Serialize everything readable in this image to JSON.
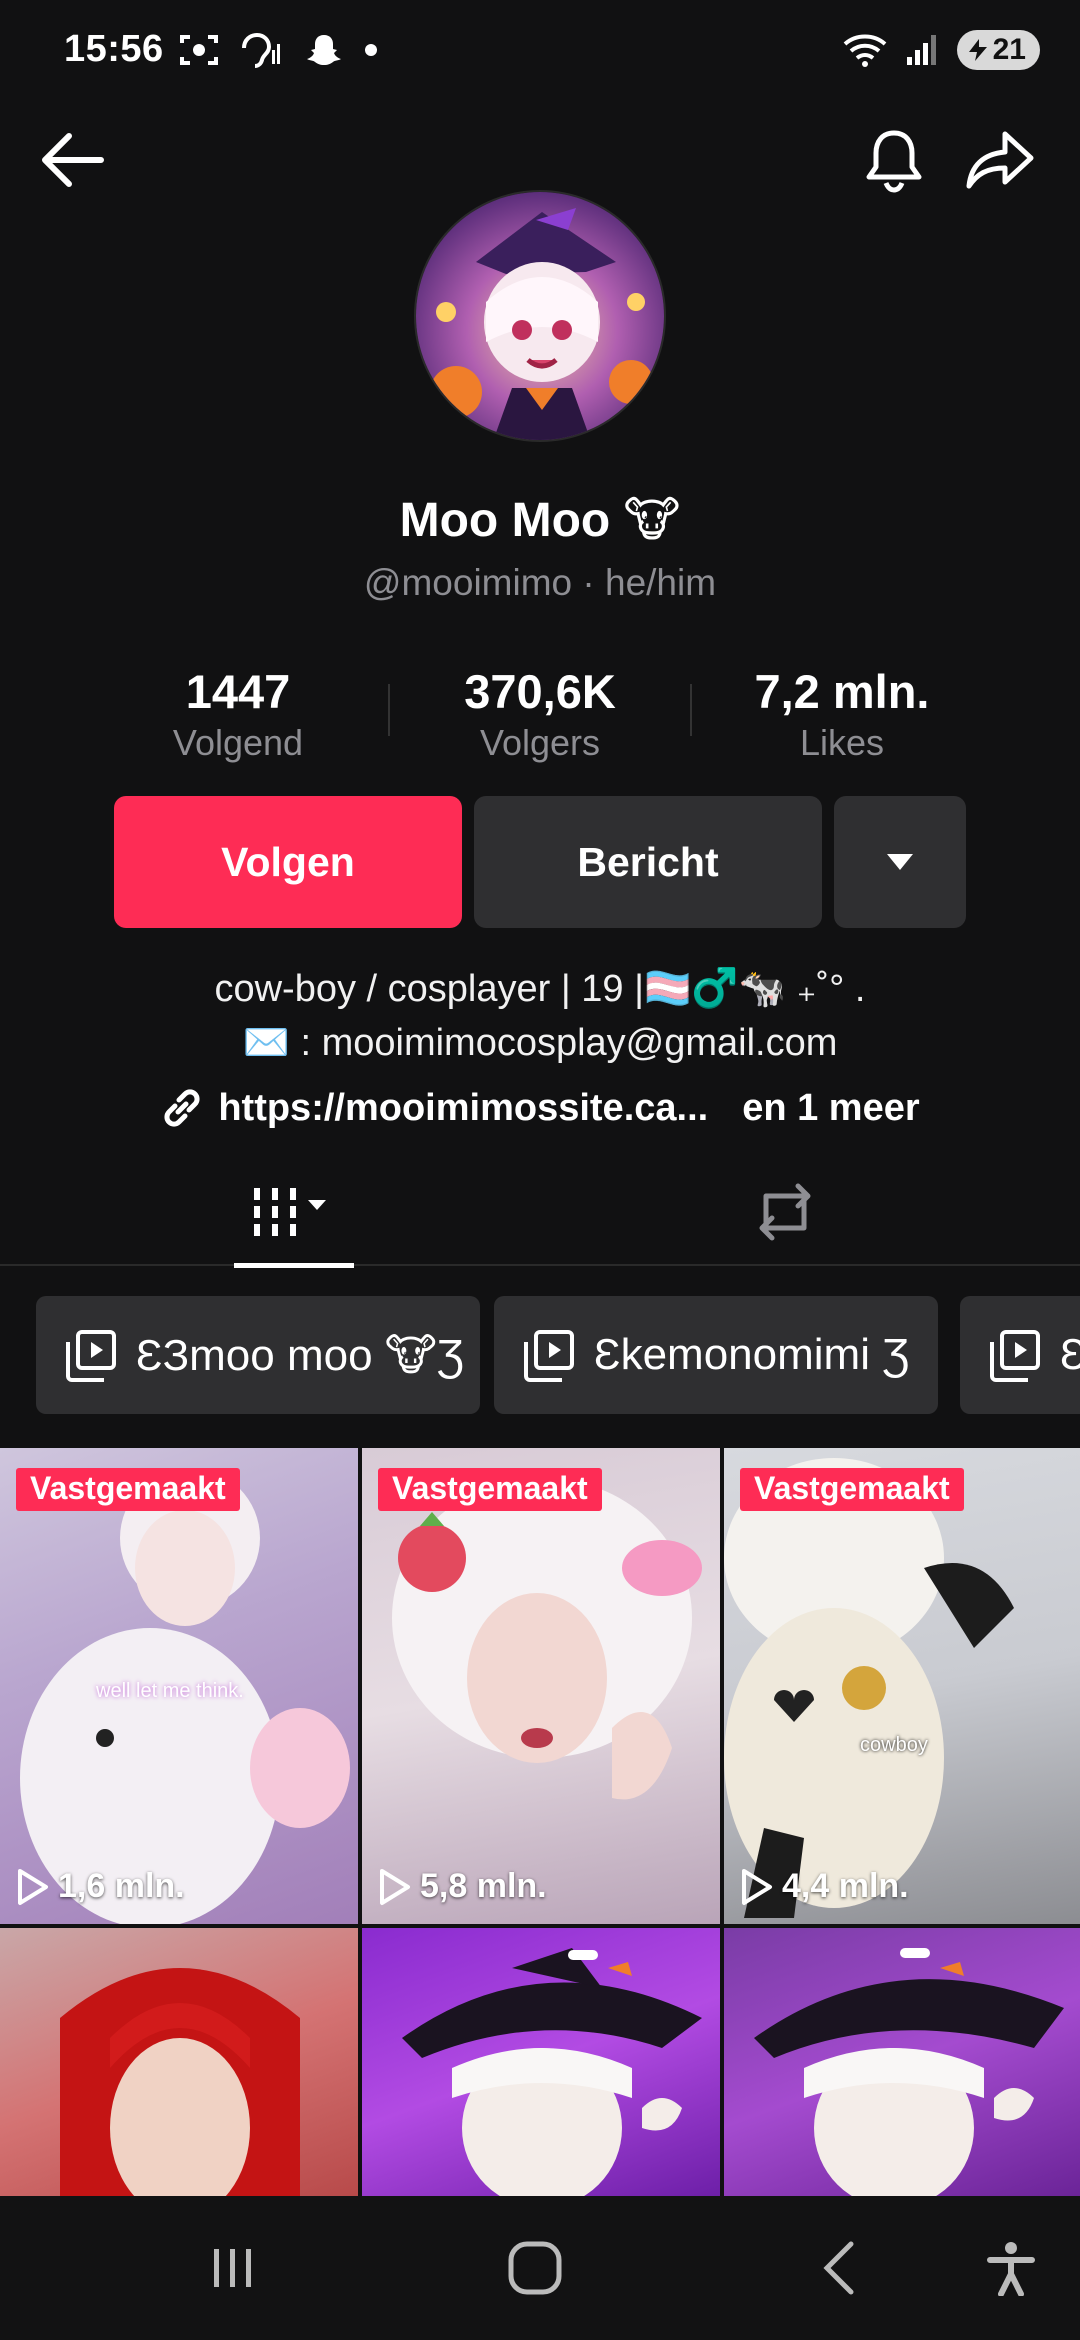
{
  "status_bar": {
    "time": "15:56",
    "battery": "21",
    "icons_left": [
      "scan-icon",
      "hearing-icon",
      "snapchat-icon",
      "dot-icon"
    ],
    "icons_right": [
      "wifi-icon",
      "signal-icon",
      "battery-icon"
    ]
  },
  "profile": {
    "display_name": "Moo Moo 🐮",
    "handle_line": "@mooimimo · he/him",
    "stats": [
      {
        "value": "1447",
        "label": "Volgend"
      },
      {
        "value": "370,6K",
        "label": "Volgers"
      },
      {
        "value": "7,2 mln.",
        "label": "Likes"
      }
    ],
    "follow_label": "Volgen",
    "message_label": "Bericht",
    "bio_line1": "cow-boy / cosplayer | 19 |🏳️‍⚧️♂️🐄 ₊˚° .",
    "bio_line2": "✉️ : mooimimocosplay@gmail.com",
    "link_text": "https://mooimimossite.ca...",
    "link_more": "en 1 meer"
  },
  "playlists": [
    {
      "label": "ƐЗmoo moo 🐮Ʒ"
    },
    {
      "label": "Ɛkemonomimi Ʒ"
    },
    {
      "label": "Ɛ"
    }
  ],
  "videos": [
    {
      "pinned": "Vastgemaakt",
      "views": "1,6 mln.",
      "overlay": "well let me think."
    },
    {
      "pinned": "Vastgemaakt",
      "views": "5,8 mln.",
      "overlay": ""
    },
    {
      "pinned": "Vastgemaakt",
      "views": "4,4 mln.",
      "overlay": "cowboy"
    },
    {
      "pinned": "",
      "views": "",
      "overlay": ""
    },
    {
      "pinned": "",
      "views": "",
      "overlay": ""
    },
    {
      "pinned": "",
      "views": "",
      "overlay": ""
    }
  ],
  "colors": {
    "background": "#111112",
    "accent": "#fe2c55",
    "button_dark": "#2f2f31",
    "muted_text": "#8e8e93"
  }
}
